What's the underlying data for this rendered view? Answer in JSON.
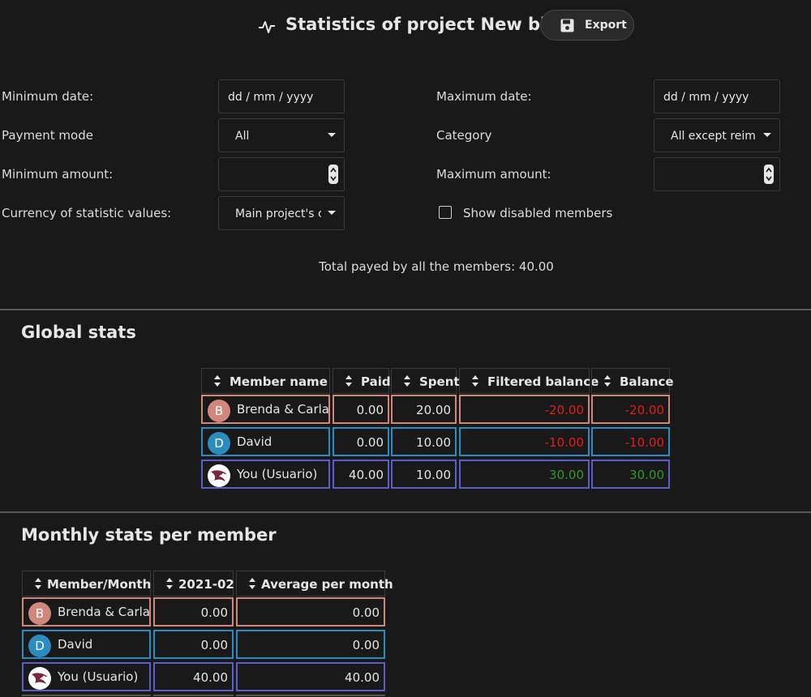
{
  "header": {
    "title": "Statistics of project New bill",
    "export_label": "Export"
  },
  "filters": {
    "min_date_label": "Minimum date:",
    "min_date_value": "dd / mm / yyyy",
    "max_date_label": "Maximum date:",
    "max_date_value": "dd / mm / yyyy",
    "payment_mode_label": "Payment mode",
    "payment_mode_value": "All",
    "category_label": "Category",
    "category_value": "All except reimb",
    "min_amount_label": "Minimum amount:",
    "max_amount_label": "Maximum amount:",
    "currency_label": "Currency of statistic values:",
    "currency_value": "Main project's currency",
    "show_disabled_label": "Show disabled members"
  },
  "total_text": "Total payed by all the members: 40.00",
  "global_stats": {
    "title": "Global stats",
    "columns": [
      "Member name",
      "Paid",
      "Spent",
      "Filtered balance",
      "Balance"
    ],
    "rows": [
      {
        "avatar": "B",
        "name": "Brenda & Carla",
        "paid": "0.00",
        "spent": "20.00",
        "filtered_balance": "-20.00",
        "balance": "-20.00"
      },
      {
        "avatar": "D",
        "name": "David",
        "paid": "0.00",
        "spent": "10.00",
        "filtered_balance": "-10.00",
        "balance": "-10.00"
      },
      {
        "avatar": "",
        "name": "You (Usuario)",
        "paid": "40.00",
        "spent": "10.00",
        "filtered_balance": "30.00",
        "balance": "30.00"
      }
    ]
  },
  "monthly_stats": {
    "title": "Monthly stats per member",
    "columns": [
      "Member/Month",
      "2021-02",
      "Average per month"
    ],
    "rows": [
      {
        "avatar": "B",
        "name": "Brenda & Carla",
        "m2021_02": "0.00",
        "average": "0.00"
      },
      {
        "avatar": "D",
        "name": "David",
        "m2021_02": "0.00",
        "average": "0.00"
      },
      {
        "avatar": "",
        "name": "You (Usuario)",
        "m2021_02": "40.00",
        "average": "40.00"
      }
    ]
  },
  "colors": {
    "brenda": "#d1877c",
    "david": "#2a8cbf",
    "you": "#5a5ec6",
    "negative": "#e41c1c",
    "positive": "#2e9a2e"
  },
  "icons": [
    "pulse-icon",
    "save-icon",
    "chevron-down-icon",
    "spinner-icon",
    "sort-icon",
    "eagle-avatar-icon"
  ]
}
